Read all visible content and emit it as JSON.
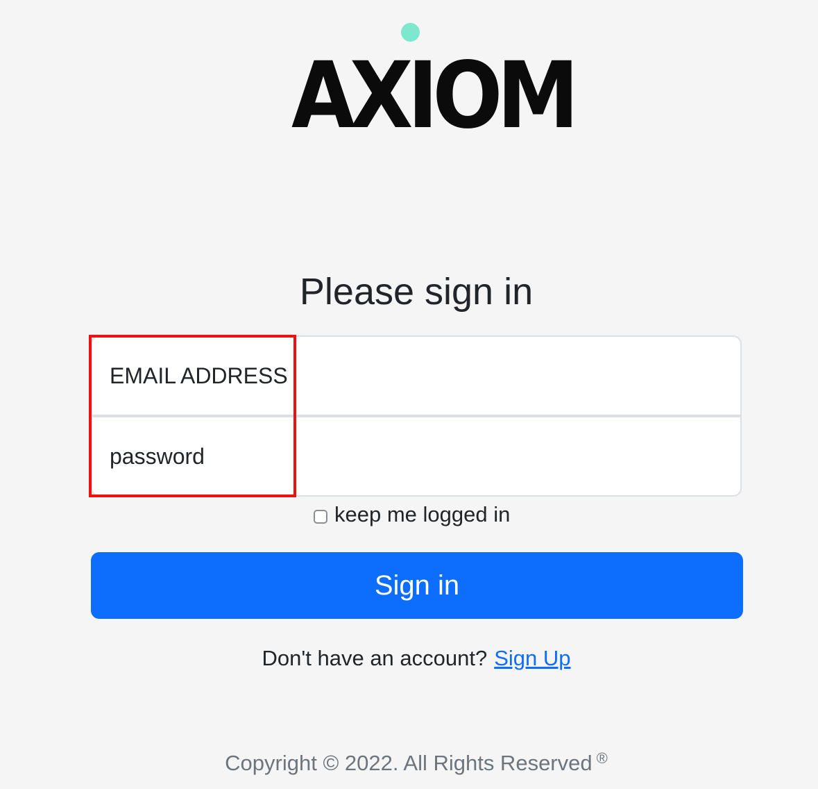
{
  "brand": {
    "logo_text": "AXIOM",
    "dot_color": "#7ee8cf"
  },
  "form": {
    "heading": "Please sign in",
    "email_placeholder": "EMAIL ADDRESS",
    "password_placeholder": "password",
    "remember_label": "keep me logged in",
    "remember_checked": false,
    "submit_label": "Sign in"
  },
  "signup": {
    "prompt": "Don't have an account?",
    "link_label": "Sign Up"
  },
  "footer": {
    "copyright": "Copyright © 2022. All Rights Reserved",
    "reg_mark": "®"
  },
  "colors": {
    "primary": "#0d6efd",
    "highlight": "#ee1111",
    "background": "#f5f5f5"
  }
}
